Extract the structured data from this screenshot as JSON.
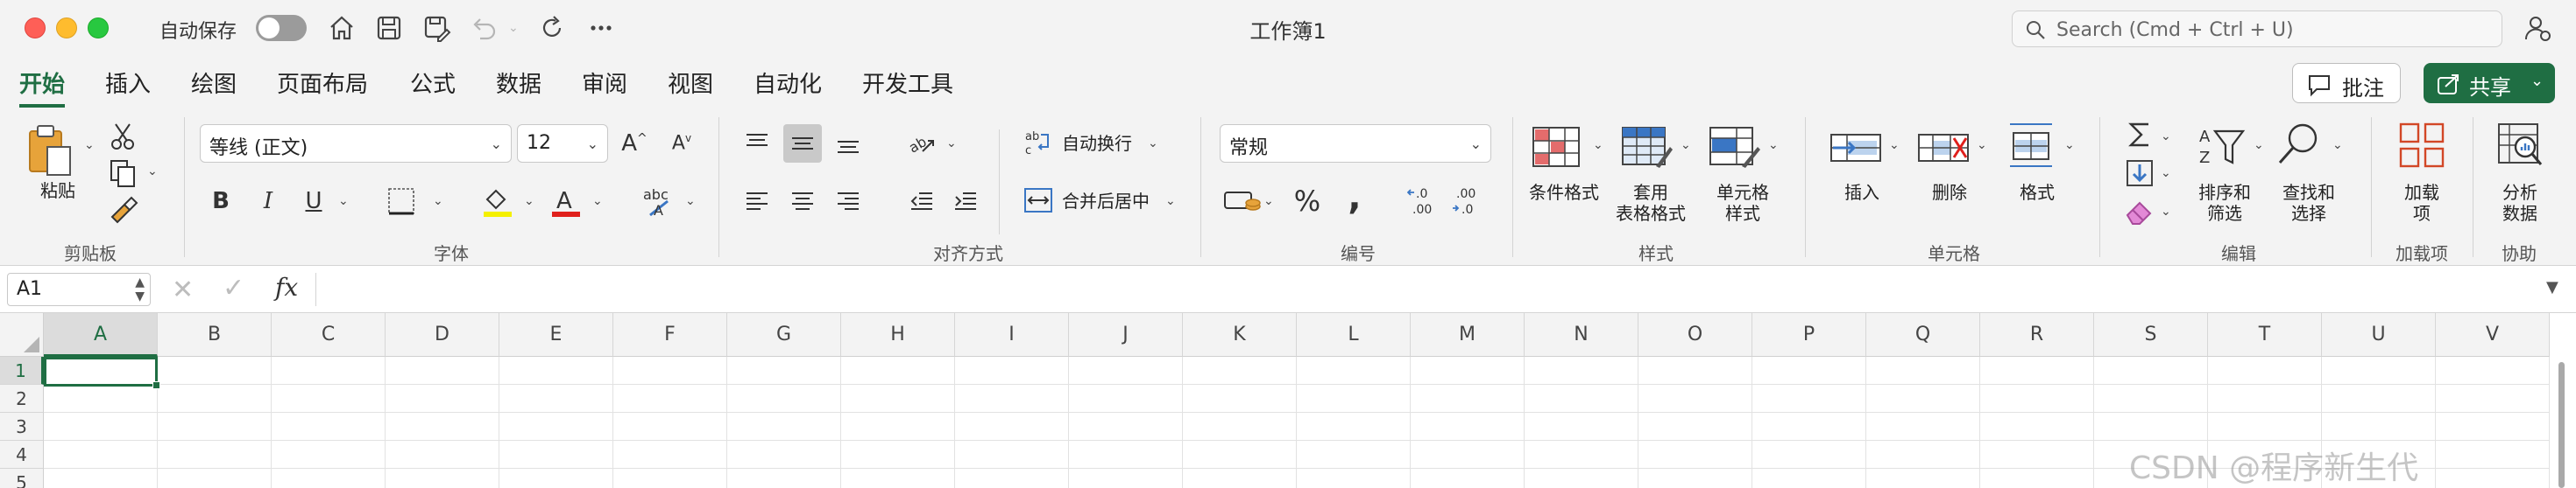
{
  "titlebar": {
    "autosave_label": "自动保存",
    "doc_title": "工作簿1",
    "search_placeholder": "Search (Cmd + Ctrl + U)"
  },
  "tabs": [
    {
      "label": "开始"
    },
    {
      "label": "插入"
    },
    {
      "label": "绘图"
    },
    {
      "label": "页面布局"
    },
    {
      "label": "公式"
    },
    {
      "label": "数据"
    },
    {
      "label": "审阅"
    },
    {
      "label": "视图"
    },
    {
      "label": "自动化"
    },
    {
      "label": "开发工具"
    }
  ],
  "actions": {
    "comment_label": "批注",
    "share_label": "共享"
  },
  "ribbon": {
    "clipboard": {
      "paste_label": "粘贴",
      "group_label": "剪贴板"
    },
    "font": {
      "font_name": "等线 (正文)",
      "font_size": "12",
      "bold": "B",
      "italic": "I",
      "underline": "U",
      "group_label": "字体"
    },
    "alignment": {
      "wrap_label": "自动换行",
      "merge_label": "合并后居中",
      "group_label": "对齐方式"
    },
    "number": {
      "format": "常规",
      "group_label": "编号"
    },
    "styles": {
      "conditional_label": "条件格式",
      "table_label_1": "套用",
      "table_label_2": "表格格式",
      "cell_style_label_1": "单元格",
      "cell_style_label_2": "样式",
      "group_label": "样式"
    },
    "cells": {
      "insert_label": "插入",
      "delete_label": "删除",
      "format_label": "格式",
      "group_label": "单元格"
    },
    "editing": {
      "sort_label_1": "排序和",
      "sort_label_2": "筛选",
      "find_label_1": "查找和",
      "find_label_2": "选择",
      "group_label": "编辑"
    },
    "addins": {
      "addin_label_1": "加载",
      "addin_label_2": "项",
      "group_label": "加载项"
    },
    "collab": {
      "analyze_label_1": "分析",
      "analyze_label_2": "数据",
      "group_label": "协助"
    }
  },
  "formula_bar": {
    "name_box": "A1",
    "fx": "fx",
    "formula": ""
  },
  "grid": {
    "columns": [
      "A",
      "B",
      "C",
      "D",
      "E",
      "F",
      "G",
      "H",
      "I",
      "J",
      "K",
      "L",
      "M",
      "N",
      "O",
      "P",
      "Q",
      "R",
      "S",
      "T",
      "U",
      "V"
    ],
    "rows": [
      "1",
      "2",
      "3",
      "4",
      "5"
    ],
    "selected_cell": "A1"
  },
  "watermark": "CSDN @程序新生代",
  "colors": {
    "accent": "#1f6e43",
    "ribbon_bg": "#f3f3f3"
  }
}
